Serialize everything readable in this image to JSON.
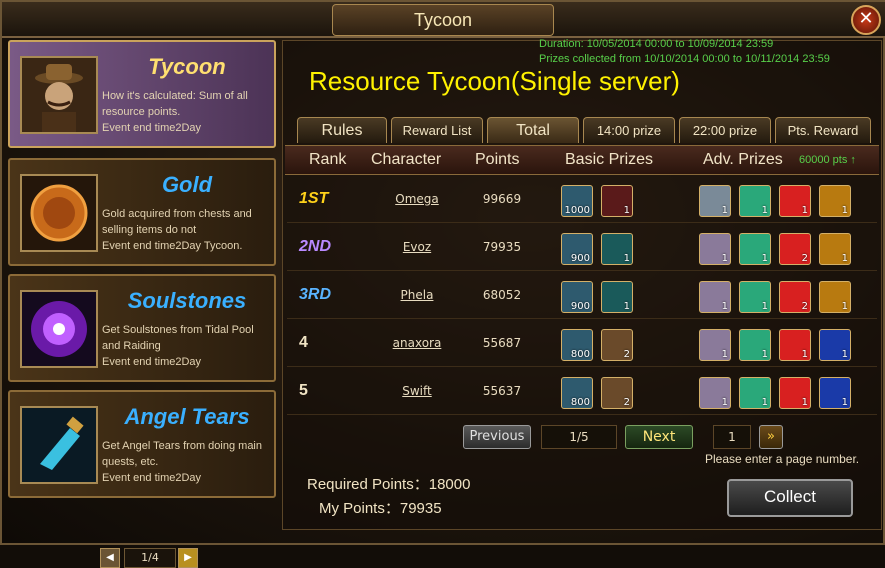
{
  "window": {
    "title": "Tycoon",
    "close_label": "✕"
  },
  "sidebar": {
    "items": [
      {
        "name": "Tycoon",
        "desc": "How it's calculated: Sum of all resource points.",
        "event_end": "Event end time2Day",
        "color": "#ffe070"
      },
      {
        "name": "Gold",
        "desc": "Gold acquired from chests and selling items do not",
        "event_end": "Event end time2Day Tycoon.",
        "color": "#3ab0ff"
      },
      {
        "name": "Soulstones",
        "desc": "Get Soulstones from Tidal Pool and Raiding",
        "event_end": "Event end time2Day",
        "color": "#3ab0ff"
      },
      {
        "name": "Angel Tears",
        "desc": "Get Angel Tears from doing main quests, etc.",
        "event_end": "Event end time2Day",
        "color": "#3ab0ff"
      }
    ],
    "pager": {
      "text": "1/4",
      "prev": "◀",
      "next": "▶"
    }
  },
  "main": {
    "duration": "Duration: 10/05/2014 00:00 to 10/09/2014 23:59",
    "prizes_collected": "Prizes collected from 10/10/2014 00:00 to 10/11/2014 23:59",
    "title": "Resource Tycoon(Single server)",
    "tabs": [
      "Rules",
      "Reward List",
      "Total",
      "14:00 prize",
      "22:00 prize",
      "Pts. Reward"
    ],
    "active_tab": "Total",
    "headers": {
      "rank": "Rank",
      "character": "Character",
      "points": "Points",
      "basic": "Basic Prizes",
      "adv": "Adv. Prizes",
      "adv_pts": "60000 pts ↑"
    },
    "rows": [
      {
        "rank": "1ST",
        "character": "Omega",
        "points": "99669",
        "basic": [
          "1000",
          "1"
        ],
        "adv": [
          "1",
          "1",
          "1",
          "1"
        ]
      },
      {
        "rank": "2ND",
        "character": "Evoz",
        "points": "79935",
        "basic": [
          "900",
          "1"
        ],
        "adv": [
          "1",
          "1",
          "2",
          "1"
        ]
      },
      {
        "rank": "3RD",
        "character": "Phela",
        "points": "68052",
        "basic": [
          "900",
          "1"
        ],
        "adv": [
          "1",
          "1",
          "2",
          "1"
        ]
      },
      {
        "rank": "4",
        "character": "anaxora",
        "points": "55687",
        "basic": [
          "800",
          "2"
        ],
        "adv": [
          "1",
          "1",
          "1",
          "1"
        ]
      },
      {
        "rank": "5",
        "character": "Swift",
        "points": "55637",
        "basic": [
          "800",
          "2"
        ],
        "adv": [
          "1",
          "1",
          "1",
          "1"
        ]
      }
    ],
    "pager": {
      "prev": "Previous",
      "page": "1/5",
      "next": "Next",
      "input_value": "1",
      "go": "»"
    },
    "hint": "Please enter a page number.",
    "required_points": "Required Points：18000",
    "my_points": "My Points：79935",
    "collect": "Collect"
  }
}
